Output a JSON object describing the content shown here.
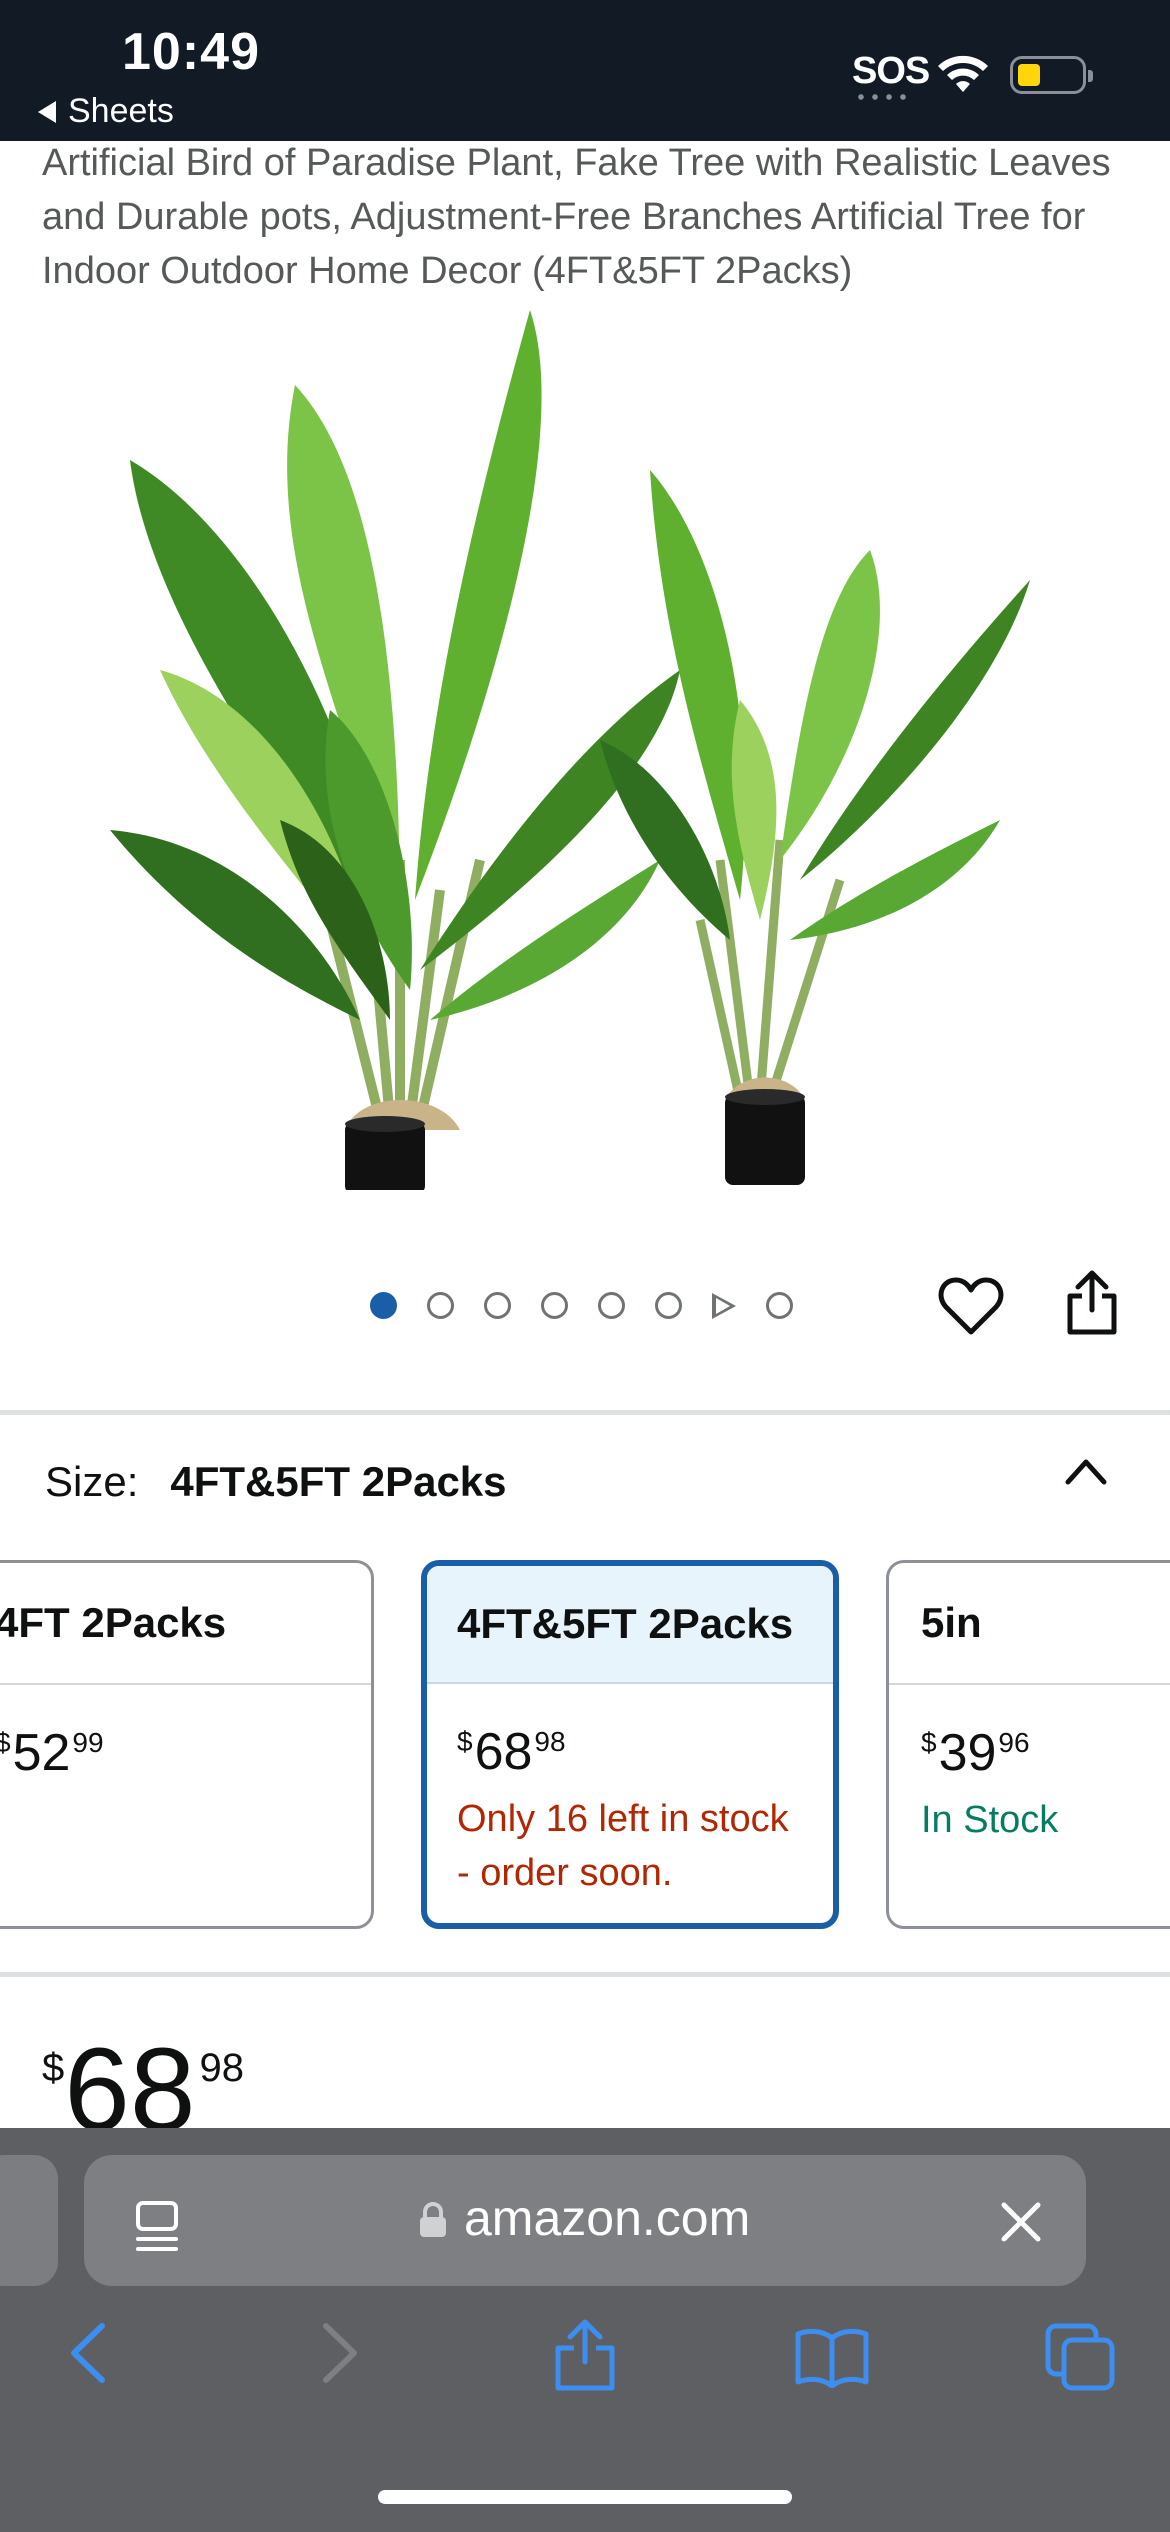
{
  "status_bar": {
    "time": "10:49",
    "back_app": "Sheets",
    "sos": "SOS"
  },
  "product": {
    "title": "Artificial Bird of Paradise Plant, Fake Tree with Realistic Leaves and Durable pots, Adjustment-Free Branches Artificial Tree for Indoor Outdoor Home Decor (4FT&5FT 2Packs)",
    "image_icon": "potted-plants-image"
  },
  "carousel": {
    "total_dots": 8,
    "active_index": 0,
    "video_index": 6,
    "favorite_icon": "heart-icon",
    "share_icon": "share-icon"
  },
  "size_selector": {
    "label": "Size:",
    "selected": "4FT&5FT 2Packs",
    "collapse_icon": "chevron-up-icon",
    "options": [
      {
        "name": "4FT 2Packs",
        "price_symbol": "$",
        "price_whole": "52",
        "price_cents": "99",
        "stock": ""
      },
      {
        "name": "4FT&5FT 2Packs",
        "price_symbol": "$",
        "price_whole": "68",
        "price_cents": "98",
        "stock": "Only 16 left in stock - order soon."
      },
      {
        "name": "5in",
        "price_symbol": "$",
        "price_whole": "39",
        "price_cents": "96",
        "stock": "In Stock"
      }
    ]
  },
  "price": {
    "symbol": "$",
    "whole": "68",
    "cents": "98"
  },
  "browser": {
    "url": "amazon.com",
    "accent_color": "#3d8ef0"
  },
  "colors": {
    "selected_border": "#1a5ea8",
    "low_stock": "#b12704",
    "in_stock": "#067d62"
  }
}
